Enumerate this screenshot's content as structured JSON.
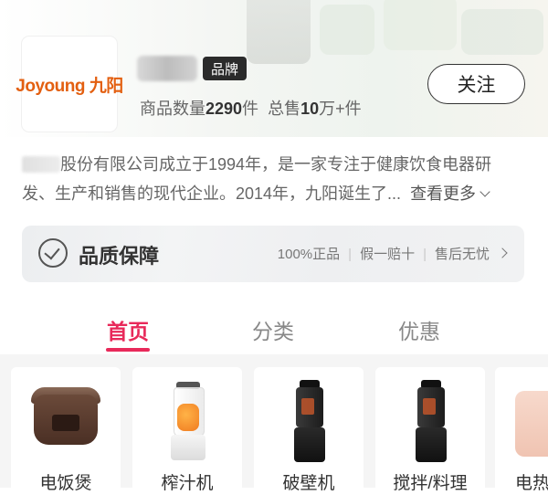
{
  "shop": {
    "logo_text": "Joyoung 九阳",
    "brand_badge": "品牌",
    "follow_label": "关注",
    "stats": {
      "products_label": "商品数量",
      "products_count": "2290",
      "products_unit": "件",
      "sales_label": "总售",
      "sales_count": "10",
      "sales_unit": "万+件"
    },
    "description_line1": "股份有限公司成立于1994年，是一家专注于健康饮食电器研",
    "description_line2": "发、生产和销售的现代企业。2014年，九阳诞生了...",
    "more_label": "查看更多"
  },
  "quality": {
    "title": "品质保障",
    "items": [
      "100%正品",
      "假一赔十",
      "售后无忧"
    ]
  },
  "tabs": [
    {
      "label": "首页",
      "active": true
    },
    {
      "label": "分类",
      "active": false
    },
    {
      "label": "优惠",
      "active": false
    }
  ],
  "categories": [
    {
      "label": "电饭煲",
      "icon": "rice-cooker"
    },
    {
      "label": "榨汁机",
      "icon": "juicer"
    },
    {
      "label": "破壁机",
      "icon": "blender"
    },
    {
      "label": "搅拌/料理",
      "icon": "blender"
    },
    {
      "label": "电热",
      "icon": "kettle"
    }
  ],
  "colors": {
    "accent": "#e8295a",
    "logo": "#e35f10",
    "badge_bg": "#2b2b2b"
  }
}
